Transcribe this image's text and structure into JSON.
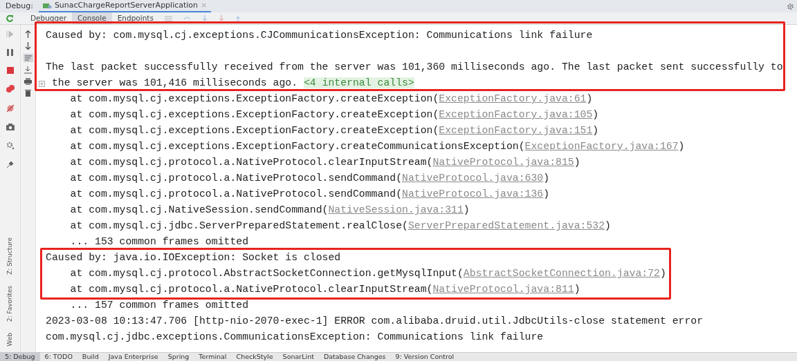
{
  "debug_bar": {
    "label": "Debug:",
    "session_tab": {
      "title": "SunacChargeReportServerApplication",
      "close": "×"
    }
  },
  "tool_tabs": [
    {
      "label": "Debugger",
      "selected": false
    },
    {
      "label": "Console",
      "selected": true
    },
    {
      "label": "Endpoints",
      "selected": false
    }
  ],
  "side_labels": [
    "Z: Structure",
    "2: Favorites",
    "Web"
  ],
  "console_lines": [
    {
      "kind": "caused",
      "text": "Caused by: com.mysql.cj.exceptions.CJCommunicationsException: Communications link failure"
    },
    {
      "kind": "blank"
    },
    {
      "kind": "plain",
      "text": "The last packet successfully received from the server was 101,360 milliseconds ago. The last packet sent successfully to"
    },
    {
      "kind": "folded",
      "text": " the server was 101,416 milliseconds ago. ",
      "chip": "<4 internal calls>"
    },
    {
      "kind": "frame",
      "text": "at com.mysql.cj.exceptions.ExceptionFactory.createException(",
      "link": "ExceptionFactory.java:61",
      "tail": ")"
    },
    {
      "kind": "frame",
      "text": "at com.mysql.cj.exceptions.ExceptionFactory.createException(",
      "link": "ExceptionFactory.java:105",
      "tail": ")"
    },
    {
      "kind": "frame",
      "text": "at com.mysql.cj.exceptions.ExceptionFactory.createException(",
      "link": "ExceptionFactory.java:151",
      "tail": ")"
    },
    {
      "kind": "frame",
      "text": "at com.mysql.cj.exceptions.ExceptionFactory.createCommunicationsException(",
      "link": "ExceptionFactory.java:167",
      "tail": ")"
    },
    {
      "kind": "frame",
      "text": "at com.mysql.cj.protocol.a.NativeProtocol.clearInputStream(",
      "link": "NativeProtocol.java:815",
      "tail": ")"
    },
    {
      "kind": "frame",
      "text": "at com.mysql.cj.protocol.a.NativeProtocol.sendCommand(",
      "link": "NativeProtocol.java:630",
      "tail": ")"
    },
    {
      "kind": "frame",
      "text": "at com.mysql.cj.protocol.a.NativeProtocol.sendCommand(",
      "link": "NativeProtocol.java:136",
      "tail": ")"
    },
    {
      "kind": "frame",
      "text": "at com.mysql.cj.NativeSession.sendCommand(",
      "link": "NativeSession.java:311",
      "tail": ")"
    },
    {
      "kind": "frame",
      "text": "at com.mysql.cj.jdbc.ServerPreparedStatement.realClose(",
      "link": "ServerPreparedStatement.java:532",
      "tail": ")"
    },
    {
      "kind": "omitted",
      "text": "... 153 common frames omitted"
    },
    {
      "kind": "caused",
      "text": "Caused by: java.io.IOException: Socket is closed"
    },
    {
      "kind": "frame",
      "text": "at com.mysql.cj.protocol.AbstractSocketConnection.getMysqlInput(",
      "link": "AbstractSocketConnection.java:72",
      "tail": ")"
    },
    {
      "kind": "frame",
      "text": "at com.mysql.cj.protocol.a.NativeProtocol.clearInputStream(",
      "link": "NativeProtocol.java:811",
      "tail": ")"
    },
    {
      "kind": "omitted",
      "text": "... 157 common frames omitted"
    },
    {
      "kind": "plain",
      "text": "2023-03-08 10:13:47.706 [http-nio-2070-exec-1] ERROR com.alibaba.druid.util.JdbcUtils-close statement error"
    },
    {
      "kind": "plain",
      "text": "com.mysql.cj.jdbc.exceptions.CommunicationsException: Communications link failure"
    }
  ],
  "bottom_tabs": [
    {
      "label": "5: Debug",
      "selected": true
    },
    {
      "label": "6: TODO",
      "selected": false
    },
    {
      "label": "Build",
      "selected": false
    },
    {
      "label": "Java Enterprise",
      "selected": false
    },
    {
      "label": "Spring",
      "selected": false
    },
    {
      "label": "Terminal",
      "selected": false
    },
    {
      "label": "CheckStyle",
      "selected": false
    },
    {
      "label": "SonarLint",
      "selected": false
    },
    {
      "label": "Database Changes",
      "selected": false
    },
    {
      "label": "9: Version Control",
      "selected": false
    }
  ]
}
